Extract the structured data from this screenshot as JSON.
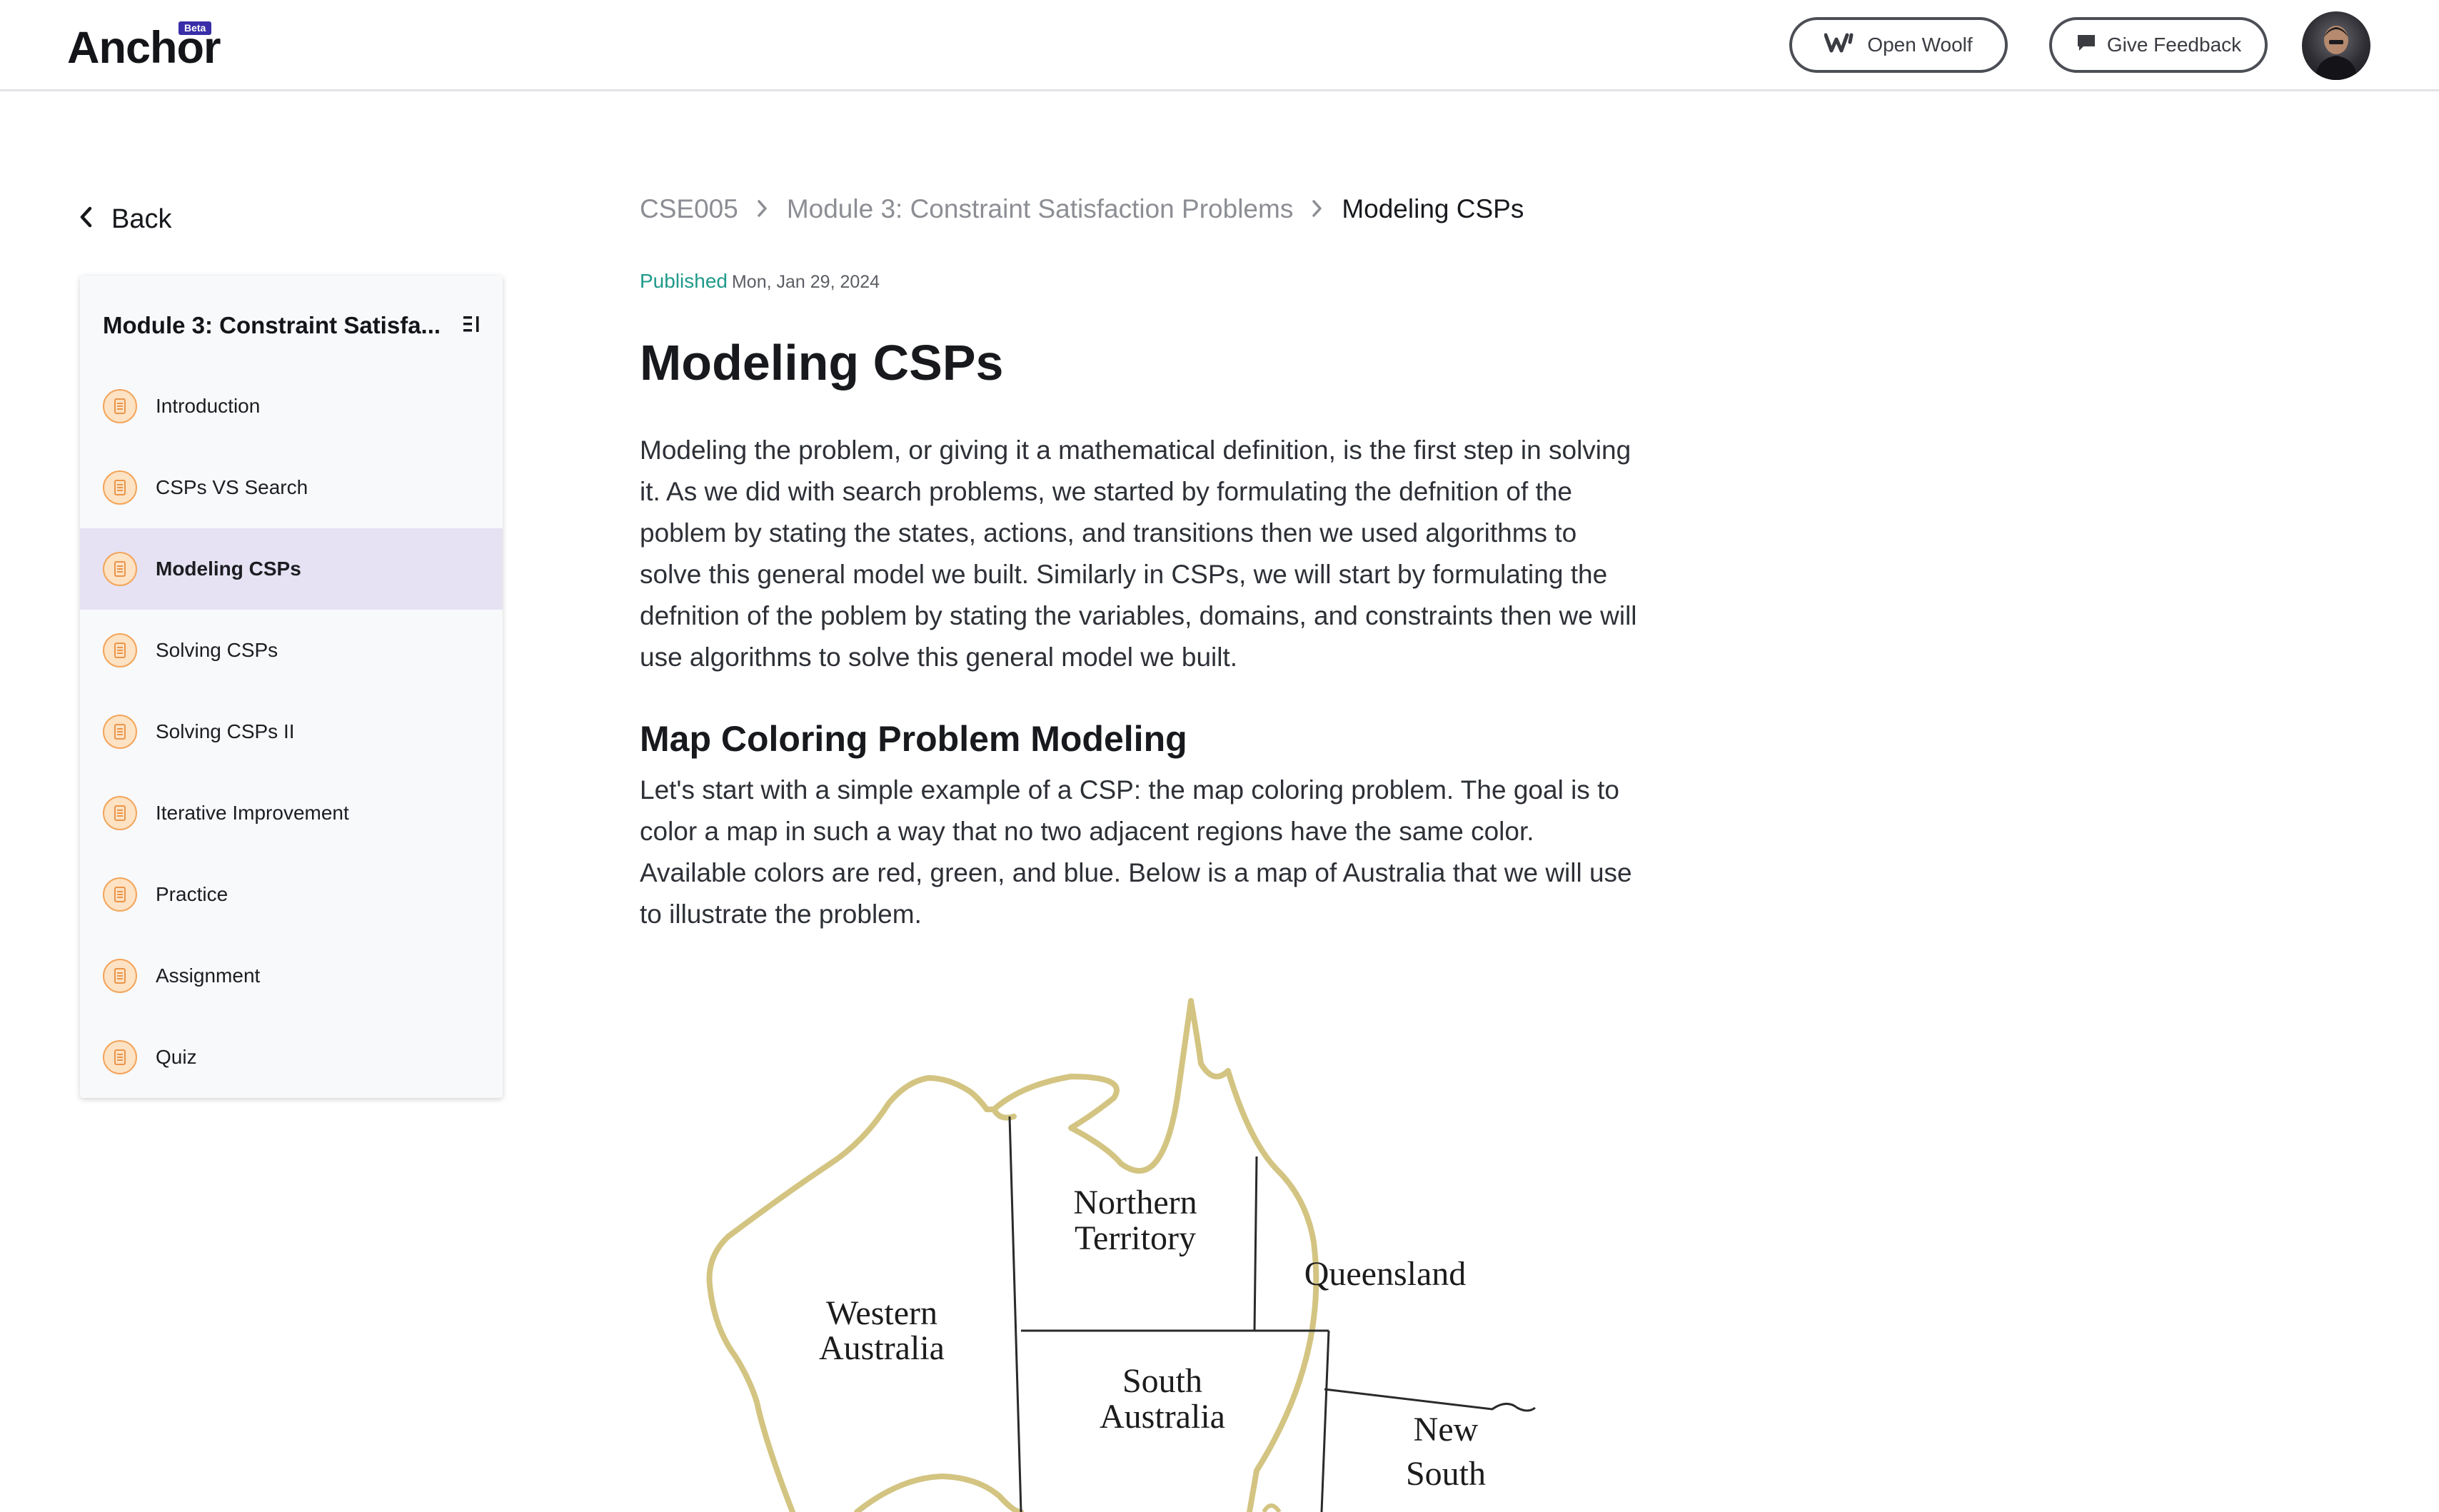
{
  "header": {
    "logo": "Anchor",
    "badge": "Beta",
    "open_woolf_label": "Open Woolf",
    "feedback_label": "Give Feedback"
  },
  "sidebar": {
    "back_label": "Back",
    "module_title": "Module 3: Constraint Satisfa...",
    "items": [
      {
        "label": "Introduction",
        "active": false
      },
      {
        "label": "CSPs VS Search",
        "active": false
      },
      {
        "label": "Modeling CSPs",
        "active": true
      },
      {
        "label": "Solving CSPs",
        "active": false
      },
      {
        "label": "Solving CSPs II",
        "active": false
      },
      {
        "label": "Iterative Improvement",
        "active": false
      },
      {
        "label": "Practice",
        "active": false
      },
      {
        "label": "Assignment",
        "active": false
      },
      {
        "label": "Quiz",
        "active": false
      }
    ]
  },
  "breadcrumb": {
    "course": "CSE005",
    "module": "Module 3: Constraint Satisfaction Problems",
    "current": "Modeling CSPs"
  },
  "article": {
    "status": "Published",
    "date": "Mon, Jan 29, 2024",
    "title": "Modeling CSPs",
    "intro": "Modeling the problem, or giving it a mathematical definition, is the first step in solving it. As we did with search problems, we started by formulating the defnition of the poblem by stating the states, actions, and transitions then we used algorithms to solve this general model we built. Similarly in CSPs, we will start by formulating the defnition of the poblem by stating the variables, domains, and constraints then we will use algorithms to solve this general model we built.",
    "section_title": "Map Coloring Problem Modeling",
    "section_body": "Let's start with a simple example of a CSP: the map coloring problem. The goal is to color a map in such a way that no two adjacent regions have the same color. Available colors are red, green, and blue. Below is a map of Australia that we will use to illustrate the problem."
  },
  "map": {
    "regions": {
      "nt_line1": "Northern",
      "nt_line2": "Territory",
      "qld": "Queensland",
      "wa_line1": "Western",
      "wa_line2": "Australia",
      "sa_line1": "South",
      "sa_line2": "Australia",
      "nsw_line1": "New",
      "nsw_line2": "South"
    },
    "outline_color": "#d3c482"
  }
}
